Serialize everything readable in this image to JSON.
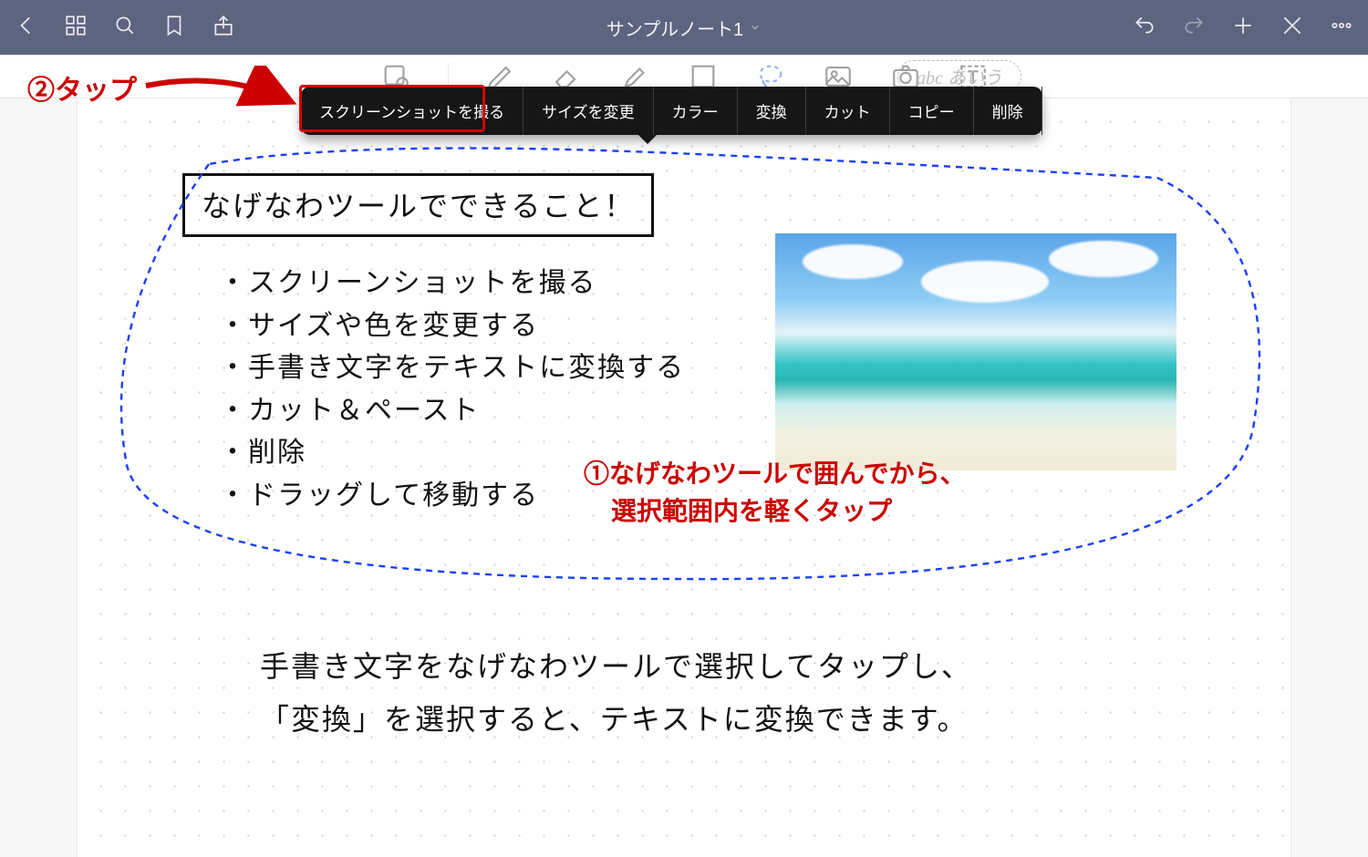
{
  "topbar": {
    "title": "サンプルノート1"
  },
  "context_menu": {
    "items": [
      "スクリーンショットを撮る",
      "サイズを変更",
      "カラー",
      "変換",
      "カット",
      "コピー",
      "削除"
    ]
  },
  "handwrite_chip": "abc あいう",
  "annotations": {
    "step2": "②タップ",
    "step1_line1": "①なげなわツールで囲んでから、",
    "step1_line2": "選択範囲内を軽くタップ"
  },
  "note": {
    "title": "なげなわツールでできること！",
    "bullets": [
      "スクリーンショットを撮る",
      "サイズや色を変更する",
      "手書き文字をテキストに変換する",
      "カット＆ペースト",
      "削除",
      "ドラッグして移動する"
    ],
    "para_line1": "手書き文字をなげなわツールで選択してタップし、",
    "para_line2": "「変換」を選択すると、テキストに変換できます。"
  }
}
